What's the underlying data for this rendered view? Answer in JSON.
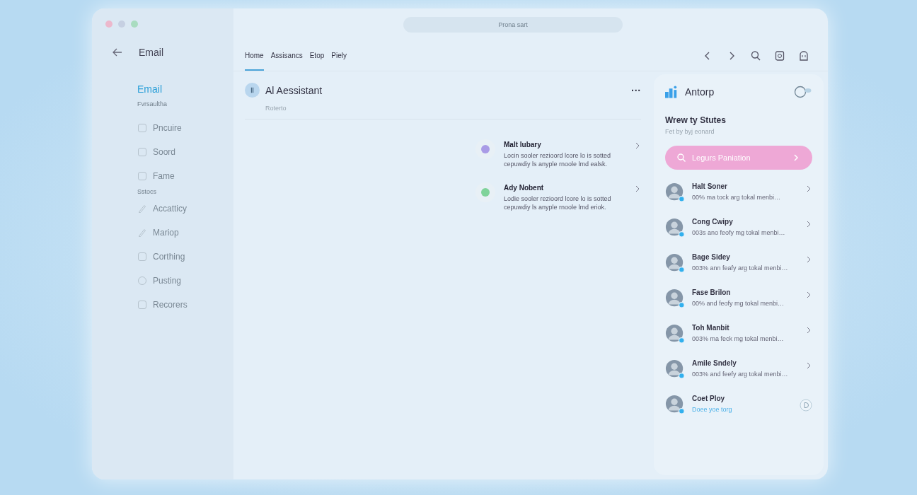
{
  "search": {
    "placeholder": "Prona sart"
  },
  "sidebar": {
    "back_title": "Email",
    "heading": "Email",
    "subheading": "Fvrsaultha",
    "items": [
      {
        "kind": "item",
        "label": "Pncuire"
      },
      {
        "kind": "item",
        "label": "Soord"
      },
      {
        "kind": "item",
        "label": "Fame"
      },
      {
        "kind": "section",
        "label": "Sstocs"
      },
      {
        "kind": "item",
        "label": "Accatticy"
      },
      {
        "kind": "item",
        "label": "Mariop"
      },
      {
        "kind": "item",
        "label": "Corthing"
      },
      {
        "kind": "item",
        "label": "Pusting"
      },
      {
        "kind": "item",
        "label": "Recorers"
      }
    ]
  },
  "tabs": [
    {
      "label": "Home",
      "selected": true
    },
    {
      "label": "Assisancs",
      "selected": false
    },
    {
      "label": "Etop",
      "selected": false
    },
    {
      "label": "Piely",
      "selected": false
    }
  ],
  "assistant": {
    "title": "Al Aessistant",
    "subtitle": "Roterto",
    "more": "···",
    "messages": [
      {
        "name": "Malt lubary",
        "text": "Locin sooler rezioord lcore lo is sotted cepuwdiy ls anyple rnoole lmd ealsk.",
        "color": "#a99be6"
      },
      {
        "name": "Ady Nobent",
        "text": "Lodie sooler rezioord lcore lo is sotted cepuwdiy ls anyple rnoole lmd eriok.",
        "color": "#7fd39a"
      }
    ]
  },
  "panel": {
    "title": "Antorp",
    "heading": "Wrew ty Stutes",
    "subheading": "Fet by byj eonard",
    "button": "Legurs Paniation",
    "contacts": [
      {
        "kind": "message",
        "name": "Halt Soner",
        "text": "00% ma tock arg tokal menbi…"
      },
      {
        "kind": "message",
        "name": "Cong Cwipy",
        "text": "003s ano feofy mg tokal menbi…"
      },
      {
        "kind": "message",
        "name": "Bage Sidey",
        "text": "003% ann feafy arg tokal menbi…"
      },
      {
        "kind": "message",
        "name": "Fase Brilon",
        "text": "00% and feofy mg tokal menbi…"
      },
      {
        "kind": "message",
        "name": "Toh Manbit",
        "text": "003% ma feck mg tokal menbi…"
      },
      {
        "kind": "message",
        "name": "Amile Sndely",
        "text": "003% and feefy arg tokal menbi…"
      },
      {
        "kind": "pending",
        "name": "Coet Ploy",
        "text": "Doee yoe torg"
      }
    ]
  }
}
